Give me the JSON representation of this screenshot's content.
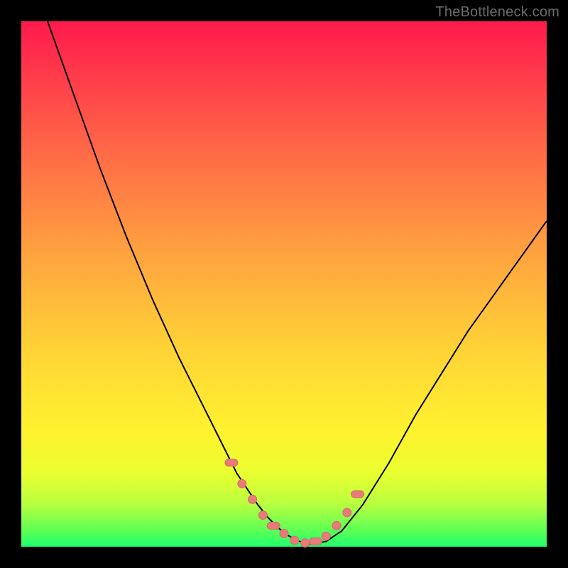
{
  "watermark": "TheBottleneck.com",
  "colors": {
    "background": "#000000",
    "gradient_top": "#ff1a4d",
    "gradient_bottom": "#1fff70",
    "curve": "#000000",
    "marker": "#e87a7a"
  },
  "chart_data": {
    "type": "line",
    "title": "",
    "xlabel": "",
    "ylabel": "",
    "xlim": [
      0,
      100
    ],
    "ylim": [
      0,
      100
    ],
    "grid": false,
    "legend": false,
    "series": [
      {
        "name": "curve",
        "x": [
          5,
          10,
          15,
          20,
          25,
          30,
          35,
          38,
          41,
          43,
          45,
          47,
          49,
          51,
          53,
          55,
          58,
          61,
          65,
          70,
          75,
          80,
          85,
          90,
          95,
          100
        ],
        "y": [
          100,
          86,
          72,
          59,
          47,
          36,
          26,
          20,
          14,
          11,
          8,
          5.5,
          3.5,
          2,
          1,
          0.5,
          1,
          3,
          8,
          16,
          25,
          33,
          41,
          48,
          55,
          62
        ]
      }
    ],
    "markers": {
      "name": "highlight-points",
      "x": [
        40,
        42,
        44,
        46,
        48,
        50,
        52,
        54,
        56,
        58,
        60,
        62,
        64
      ],
      "y": [
        16,
        12,
        9,
        6,
        4,
        2.5,
        1.2,
        0.7,
        1,
        2,
        4,
        6.5,
        10
      ]
    }
  }
}
